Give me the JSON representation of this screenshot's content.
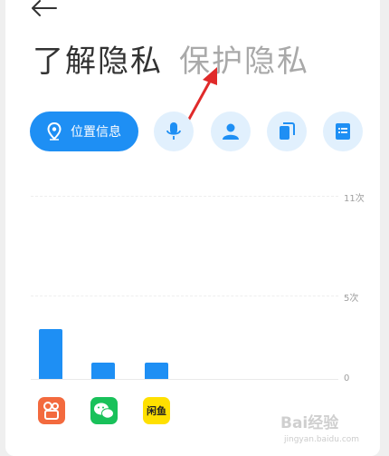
{
  "header": {
    "tab_active": "了解隐私",
    "tab_inactive": "保护隐私"
  },
  "categories": {
    "primary_label": "位置信息",
    "primary_icon": "location-pin-icon",
    "others": [
      "microphone-icon",
      "contacts-person-icon",
      "files-icon",
      "notes-list-icon"
    ]
  },
  "chart_data": {
    "type": "bar",
    "categories": [
      "快手",
      "微信",
      "闲鱼"
    ],
    "values": [
      3,
      1,
      1
    ],
    "ylim": [
      0,
      11
    ],
    "yticks": [
      "11次",
      "5次",
      "0"
    ],
    "grid": true
  },
  "apps": [
    {
      "name": "快手",
      "color": "#f36a3e"
    },
    {
      "name": "微信",
      "color": "#19c15a"
    },
    {
      "name": "闲鱼",
      "color": "#ffe000",
      "label": "闲鱼"
    }
  ],
  "colors": {
    "accent": "#1e8ff4",
    "annotation_arrow": "#e02a2a"
  },
  "watermark": {
    "main": "Bai经验",
    "sub": "jingyan.baidu.com"
  }
}
